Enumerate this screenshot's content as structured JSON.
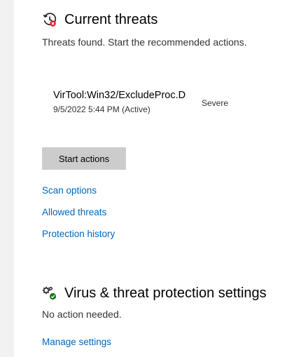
{
  "current_threats": {
    "title": "Current threats",
    "subtitle": "Threats found. Start the recommended actions.",
    "threat": {
      "name": "VirTool:Win32/ExcludeProc.D",
      "date": "9/5/2022 5:44 PM (Active)",
      "severity": "Severe"
    },
    "start_actions_label": "Start actions",
    "links": {
      "scan_options": "Scan options",
      "allowed_threats": "Allowed threats",
      "protection_history": "Protection history"
    },
    "icon": "clock-history-alert-icon"
  },
  "settings_section": {
    "title": "Virus & threat protection settings",
    "subtitle": "No action needed.",
    "manage_settings_label": "Manage settings",
    "icon": "gears-check-icon"
  },
  "colors": {
    "link": "#0067b8",
    "button_bg": "#cccccc",
    "alert_red": "#e81123",
    "ok_green": "#107c10"
  }
}
